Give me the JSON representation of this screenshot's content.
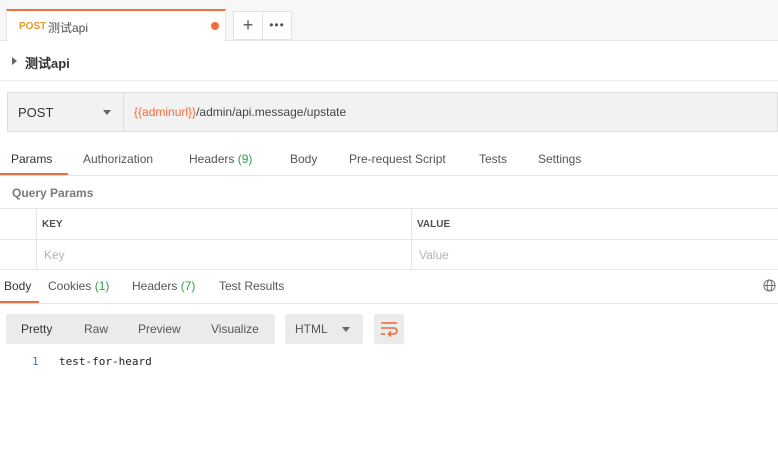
{
  "tab": {
    "method": "POST",
    "name": "测试api"
  },
  "tab_actions": {
    "new_tab": "+",
    "more": "•••"
  },
  "request_title": "测试api",
  "url_bar": {
    "method": "POST",
    "url_variable": "{{adminurl}}",
    "url_path": "/admin/api.message/upstate"
  },
  "request_tabs": [
    {
      "label": "Params"
    },
    {
      "label": "Authorization"
    },
    {
      "label": "Headers",
      "count": "(9)"
    },
    {
      "label": "Body"
    },
    {
      "label": "Pre-request Script"
    },
    {
      "label": "Tests"
    },
    {
      "label": "Settings"
    }
  ],
  "query_params": {
    "title": "Query Params",
    "key_header": "KEY",
    "value_header": "VALUE",
    "key_placeholder": "Key",
    "value_placeholder": "Value"
  },
  "response_tabs": [
    {
      "label": "Body"
    },
    {
      "label": "Cookies",
      "count": "(1)"
    },
    {
      "label": "Headers",
      "count": "(7)"
    },
    {
      "label": "Test Results"
    }
  ],
  "format_buttons": [
    "Pretty",
    "Raw",
    "Preview",
    "Visualize"
  ],
  "language": "HTML",
  "response_body": {
    "line_number": "1",
    "text": "test-for-heard"
  },
  "colors": {
    "accent": "#f26b3a",
    "count_green": "#2e9f4b",
    "method_orange": "#e69a27"
  },
  "icons": [
    "plus-icon",
    "more-icon",
    "caret-right-icon",
    "chevron-down-icon",
    "globe-icon",
    "wrap-lines-icon"
  ]
}
